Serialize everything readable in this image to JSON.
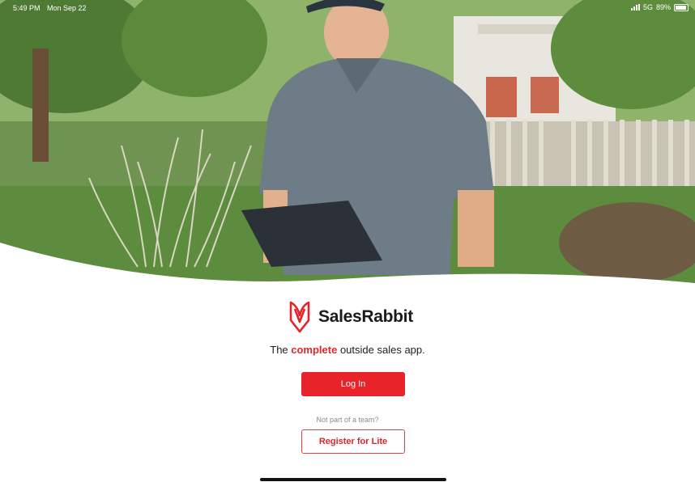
{
  "status_bar": {
    "time": "5:49 PM",
    "date": "Mon Sep 22",
    "network": "5G",
    "battery": "89%"
  },
  "app": {
    "name": "SalesRabbit",
    "tagline_prefix": "The ",
    "tagline_accent": "complete",
    "tagline_suffix": " outside sales app."
  },
  "actions": {
    "login_label": "Log In",
    "no_team_text": "Not part of a team?",
    "register_label": "Register for Lite"
  },
  "colors": {
    "brand_red": "#e8232a"
  },
  "icons": {
    "logo": "salesrabbit-logo-icon"
  }
}
